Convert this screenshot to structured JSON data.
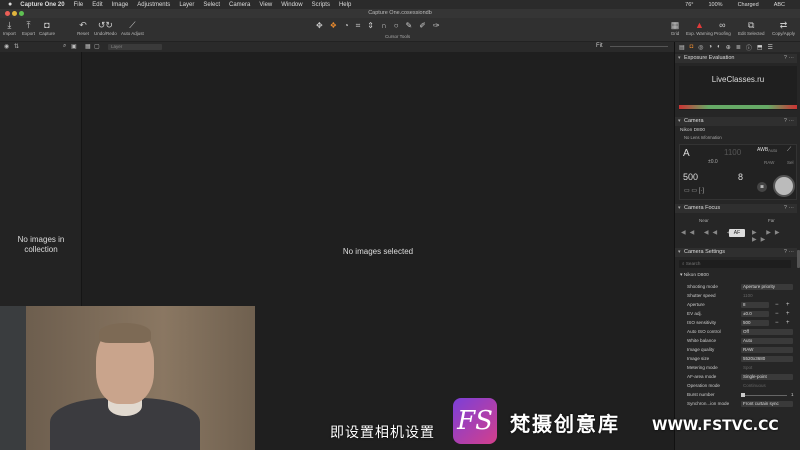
{
  "menubar": {
    "app_name": "Capture One 20",
    "items": [
      "File",
      "Edit",
      "Image",
      "Adjustments",
      "Layer",
      "Select",
      "Camera",
      "View",
      "Window",
      "Scripts",
      "Help"
    ],
    "status": [
      "76°",
      "100%",
      "Charged",
      "ABC"
    ]
  },
  "window": {
    "title": "Capture One.cosessiondb"
  },
  "toolbar": {
    "import": "Import",
    "export": "Export",
    "capture": "Capture",
    "reset": "Reset",
    "undo_redo": "Undo/Redo",
    "auto_adjust": "Auto Adjust",
    "cursor_tools": "Cursor Tools",
    "grid": "Grid",
    "exposure_warning": "Exp. Warning",
    "proofing": "Proofing",
    "edit_selected": "Edit Selected",
    "copy_apply": "Copy/Apply"
  },
  "browser": {
    "layer_label": "Layer",
    "empty": "No images in collection"
  },
  "viewer": {
    "fit_label": "Fit",
    "empty": "No images selected"
  },
  "exposure_evaluation": {
    "title": "Exposure Evaluation",
    "overlay_text": "LiveClasses.ru"
  },
  "camera": {
    "title": "Camera",
    "model": "Nikon D800",
    "lens": "No Lens Information",
    "mode": "A",
    "shutter": "1100",
    "ev": "±0.0",
    "iso": "500",
    "aperture": "8",
    "wb_label": "AWB",
    "wb_sub": "Auto",
    "raw_label": "RAW",
    "sel_label": "Sel"
  },
  "camera_focus": {
    "title": "Camera Focus",
    "near": "Near",
    "far": "Far",
    "af": "AF"
  },
  "camera_settings": {
    "title": "Camera Settings",
    "search_placeholder": "Search",
    "group": "Nikon D800",
    "rows": [
      {
        "label": "Shooting mode",
        "value": "Aperture priority"
      },
      {
        "label": "Shutter speed",
        "value": "1100"
      },
      {
        "label": "Aperture",
        "value": "8"
      },
      {
        "label": "EV adj.",
        "value": "±0.0"
      },
      {
        "label": "ISO sensitivity",
        "value": "500"
      },
      {
        "label": "Auto ISO control",
        "value": "Off"
      },
      {
        "label": "White balance",
        "value": "Auto"
      },
      {
        "label": "Image quality",
        "value": "RAW"
      },
      {
        "label": "Image size",
        "value": "5520x3680"
      },
      {
        "label": "Metering mode",
        "value": "Spot"
      },
      {
        "label": "AF-area mode",
        "value": "Single-point"
      },
      {
        "label": "Operation mode",
        "value": "Continuous"
      },
      {
        "label": "Burst number",
        "value": "1"
      },
      {
        "label": "Synchron...ion mode",
        "value": "Front curtain sync"
      }
    ]
  },
  "overlay": {
    "subtitle": "即设置相机设置",
    "watermark_logo": "FS",
    "watermark_cn": "梵摄创意库",
    "watermark_url": "WWW.FSTVC.CC"
  }
}
